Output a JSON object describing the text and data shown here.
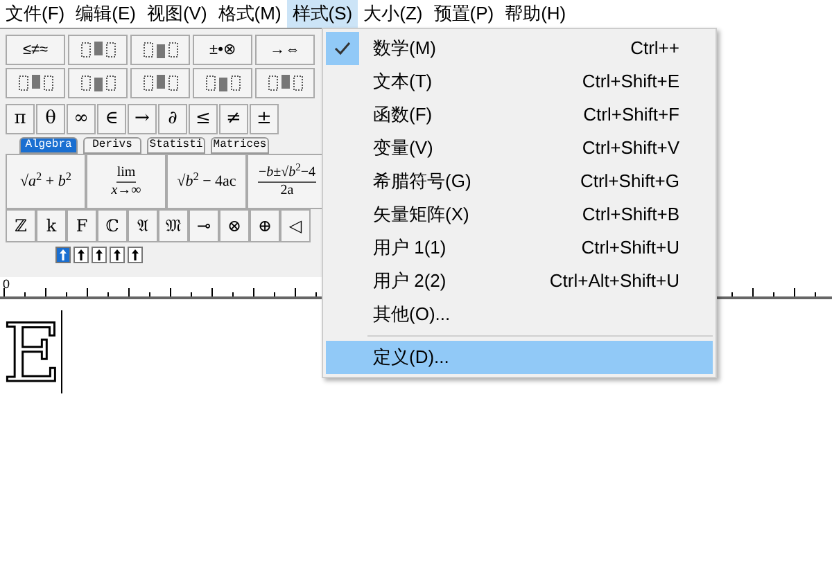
{
  "menu_bar": [
    {
      "label": "文件(F)",
      "selected": false
    },
    {
      "label": "编辑(E)",
      "selected": false
    },
    {
      "label": "视图(V)",
      "selected": false
    },
    {
      "label": "格式(M)",
      "selected": false
    },
    {
      "label": "样式(S)",
      "selected": true
    },
    {
      "label": "大小(Z)",
      "selected": false
    },
    {
      "label": "预置(P)",
      "selected": false
    },
    {
      "label": "帮助(H)",
      "selected": false
    }
  ],
  "style_menu": [
    {
      "kind": "item",
      "label": "数学(M)",
      "shortcut": "Ctrl++",
      "checked": true,
      "selected": false
    },
    {
      "kind": "item",
      "label": "文本(T)",
      "shortcut": "Ctrl+Shift+E",
      "checked": false,
      "selected": false
    },
    {
      "kind": "item",
      "label": "函数(F)",
      "shortcut": "Ctrl+Shift+F",
      "checked": false,
      "selected": false
    },
    {
      "kind": "item",
      "label": "变量(V)",
      "shortcut": "Ctrl+Shift+V",
      "checked": false,
      "selected": false
    },
    {
      "kind": "item",
      "label": "希腊符号(G)",
      "shortcut": "Ctrl+Shift+G",
      "checked": false,
      "selected": false
    },
    {
      "kind": "item",
      "label": "矢量矩阵(X)",
      "shortcut": "Ctrl+Shift+B",
      "checked": false,
      "selected": false
    },
    {
      "kind": "item",
      "label": "用户 1(1)",
      "shortcut": "Ctrl+Shift+U",
      "checked": false,
      "selected": false
    },
    {
      "kind": "item",
      "label": "用户 2(2)",
      "shortcut": "Ctrl+Alt+Shift+U",
      "checked": false,
      "selected": false
    },
    {
      "kind": "item",
      "label": "其他(O)...",
      "checked": false,
      "selected": false
    },
    {
      "kind": "separator"
    },
    {
      "kind": "item",
      "label": "定义(D)...",
      "checked": false,
      "selected": true
    }
  ],
  "palette_rows": [
    [
      {
        "kind": "text",
        "text": "≤≠≈"
      },
      {
        "kind": "icon"
      },
      {
        "kind": "icon"
      },
      {
        "kind": "text",
        "text": "±•⊗"
      },
      {
        "kind": "text",
        "text": "→⇔"
      }
    ],
    [
      {
        "kind": "icon"
      },
      {
        "kind": "icon"
      },
      {
        "kind": "icon"
      },
      {
        "kind": "icon"
      },
      {
        "kind": "icon"
      }
    ]
  ],
  "symbols": [
    "π",
    "θ",
    "∞",
    "∈",
    "→",
    "∂",
    "≤",
    "≠",
    "±"
  ],
  "tabs": [
    {
      "label": "Algebra",
      "selected": true
    },
    {
      "label": "Derivs",
      "selected": false
    },
    {
      "label": "Statisti",
      "selected": false
    },
    {
      "label": "Matrices",
      "selected": false
    }
  ],
  "templates": [
    {
      "kind": "inline",
      "text": "√*a*$^{2}$ + *b*$^{2}$"
    },
    {
      "kind": "stacked",
      "top": "lim",
      "bottom": "*x*→∞"
    },
    {
      "kind": "inline",
      "text": "√*b*$^{2}$ − 4ac"
    },
    {
      "kind": "stacked",
      "top": "−*b*±√*b*$^{2}$−4",
      "bottom": "2a"
    }
  ],
  "letters": [
    "ℤ",
    "k",
    "F",
    "ℂ",
    "𝔄",
    "𝔐",
    "⊸",
    "⊗",
    "⊕",
    "◁"
  ],
  "size_tabs": [
    {
      "selected": true
    },
    {
      "selected": false
    },
    {
      "selected": false
    },
    {
      "selected": false
    },
    {
      "selected": false
    }
  ],
  "ruler_label": "0",
  "document_text": "E"
}
